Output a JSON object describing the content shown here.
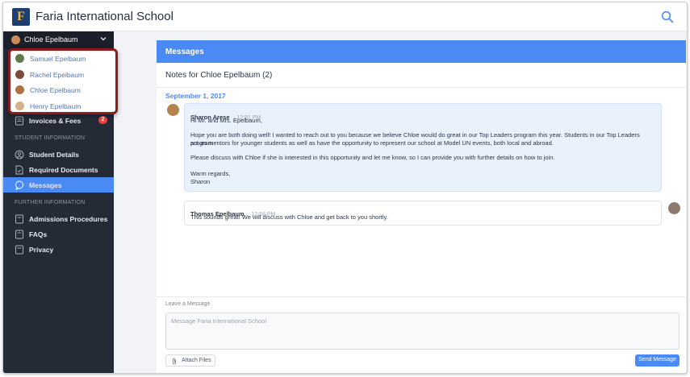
{
  "app": {
    "title": "Faria International School",
    "logo_letter": "F"
  },
  "colors": {
    "accent": "#4a8af5",
    "sidebar": "#252a37",
    "highlight_border": "#8e1b1b",
    "badge": "#e8453c"
  },
  "sidebar": {
    "current_user": "Chloe Epelbaum",
    "switcher": [
      {
        "name": "Samuel Epelbaum",
        "avatar_color": "#5e7a4c"
      },
      {
        "name": "Rachel Epelbaum",
        "avatar_color": "#7a4a3a"
      },
      {
        "name": "Chloe Epelbaum",
        "avatar_color": "#b07040"
      },
      {
        "name": "Henry Epelbaum",
        "avatar_color": "#d8b08c"
      }
    ],
    "invoices": {
      "label": "Invoices & Fees",
      "badge": "2",
      "icon": "invoice-icon"
    },
    "section_student": "STUDENT INFORMATION",
    "student_items": [
      {
        "label": "Student Details",
        "icon": "person-icon"
      },
      {
        "label": "Required Documents",
        "icon": "document-icon"
      },
      {
        "label": "Messages",
        "icon": "chat-icon"
      }
    ],
    "section_further": "FURTHER INFORMATION",
    "further_items": [
      {
        "label": "Admissions Procedures",
        "icon": "page-icon"
      },
      {
        "label": "FAQs",
        "icon": "page-icon"
      },
      {
        "label": "Privacy",
        "icon": "page-icon"
      }
    ]
  },
  "main": {
    "header": "Messages",
    "notes_title": "Notes for Chloe Epelbaum (2)",
    "date": "September 1, 2017",
    "messages": [
      {
        "sender": "Sharon Arese",
        "time": "· 12:51 PM",
        "lines": [
          "Hi Mr. and Mrs. Epelbaum,",
          "Hope you are both doing well! I wanted to reach out to you because we believe Chloe would do great in our Top Leaders program this year. Students in our Top Leaders program",
          "act as mentors for younger students as well as have the opportunity to represent our school at Model UN events, both local and abroad.",
          "Please discuss with Chloe if she is interested in this opportunity and let me know, so I can provide you with further details on how to join.",
          "Warm regards,",
          "Sharon"
        ]
      },
      {
        "sender": "Thomas Epelbaum",
        "time": "· 12:58 PM",
        "lines": [
          "This sounds great! We will discuss with Chloe and get back to you shortly."
        ]
      }
    ],
    "compose": {
      "label": "Leave a Message",
      "placeholder": "Message Faria International School",
      "attach_label": "Attach Files",
      "send_label": "Send Message"
    }
  }
}
